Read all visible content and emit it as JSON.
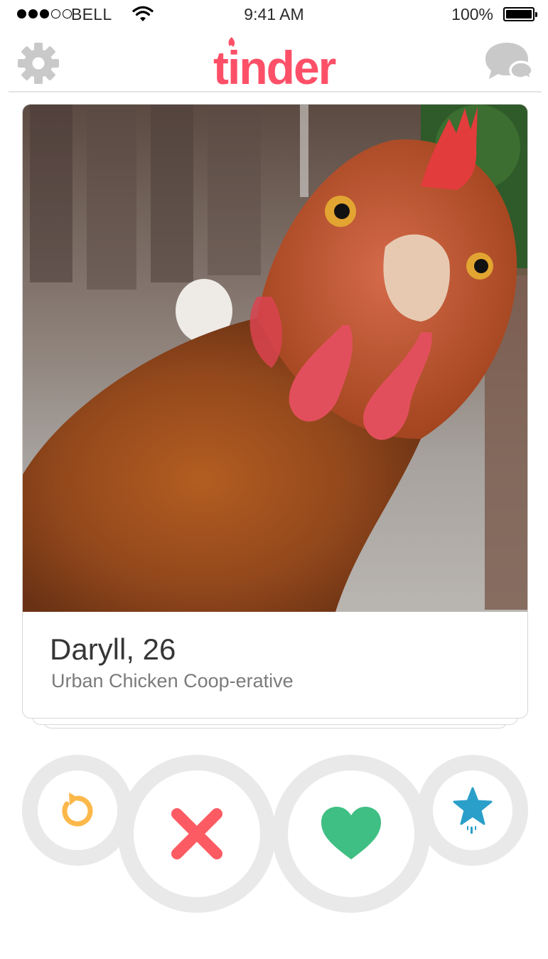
{
  "status_bar": {
    "carrier": "BELL",
    "time": "9:41 AM",
    "battery": "100%",
    "signal_bars_filled": 3,
    "signal_bars_total": 5
  },
  "nav": {
    "brand": "tinder",
    "settings_icon": "gear-icon",
    "messages_icon": "chat-bubbles-icon",
    "colors": {
      "brand": "#fd5068",
      "icon_gray": "#c9c9c9"
    }
  },
  "profile": {
    "name_age": "Daryll, 26",
    "job": "Urban Chicken Coop-erative",
    "photo_subject": "photo"
  },
  "actions": {
    "rewind": {
      "icon": "rewind-icon",
      "color": "#fcb84a"
    },
    "nope": {
      "icon": "x-icon",
      "color": "#fd5b63"
    },
    "like": {
      "icon": "heart-icon",
      "color": "#3fbf83"
    },
    "super_like": {
      "icon": "star-icon",
      "color": "#2a9fc9"
    }
  }
}
